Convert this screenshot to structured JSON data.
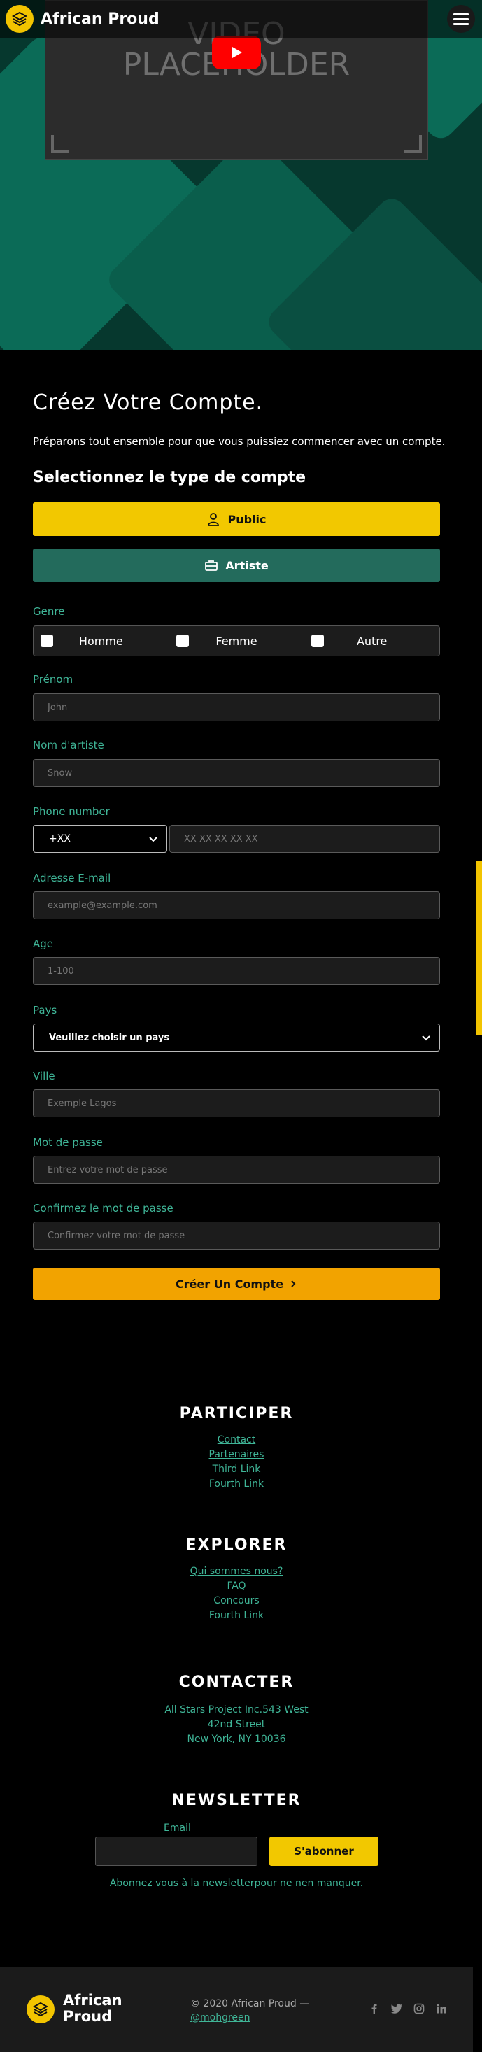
{
  "header": {
    "brand": "African Proud"
  },
  "hero": {
    "video_text_line1": "VIDEO",
    "video_text_line2": "PLACEHOLDER"
  },
  "form": {
    "title": "Créez Votre Compte.",
    "intro": "Préparons tout ensemble pour que vous puissiez commencer avec un compte.",
    "account_type_heading": "Selectionnez le type de compte",
    "account_types": {
      "public": "Public",
      "artist": "Artiste"
    },
    "genre": {
      "label": "Genre",
      "options": [
        "Homme",
        "Femme",
        "Autre"
      ]
    },
    "first_name": {
      "label": "Prénom",
      "placeholder": "John"
    },
    "artist_name": {
      "label": "Nom d'artiste",
      "placeholder": "Snow"
    },
    "phone": {
      "label": "Phone number",
      "code": "+XX",
      "placeholder": "XX XX XX XX XX"
    },
    "email": {
      "label": "Adresse E-mail",
      "placeholder": "example@example.com"
    },
    "age": {
      "label": "Age",
      "placeholder": "1-100"
    },
    "country": {
      "label": "Pays",
      "selected": "Veuillez choisir un pays"
    },
    "city": {
      "label": "Ville",
      "placeholder": "Exemple Lagos"
    },
    "password": {
      "label": "Mot de passe",
      "placeholder": "Entrez votre mot de passe"
    },
    "confirm_password": {
      "label": "Confirmez le mot de passe",
      "placeholder": "Confirmez votre mot de passe"
    },
    "submit": "Créer Un Compte"
  },
  "footer": {
    "participer": {
      "title": "PARTICIPER",
      "links": [
        "Contact",
        "Partenaires",
        "Third Link",
        "Fourth Link"
      ]
    },
    "explorer": {
      "title": "EXPLORER",
      "links": [
        "Qui sommes nous?",
        "FAQ",
        "Concours",
        "Fourth Link"
      ]
    },
    "contacter": {
      "title": "CONTACTER",
      "lines": [
        "All Stars Project Inc.543 West",
        "42nd Street",
        "New York, NY 10036"
      ]
    },
    "newsletter": {
      "title": "NEWSLETTER",
      "email_label": "Email",
      "button": "S'abonner",
      "note": "Abonnez vous à la newsletterpour ne nen manquer."
    },
    "bottom": {
      "brand_line1": "African",
      "brand_line2": "Proud",
      "copyright": "© 2020 African Proud —",
      "handle": "@mohgreen"
    }
  },
  "colors": {
    "accent": "#f2c800",
    "teal": "#236b5c",
    "link": "#3fb597",
    "submit": "#f2a300"
  }
}
